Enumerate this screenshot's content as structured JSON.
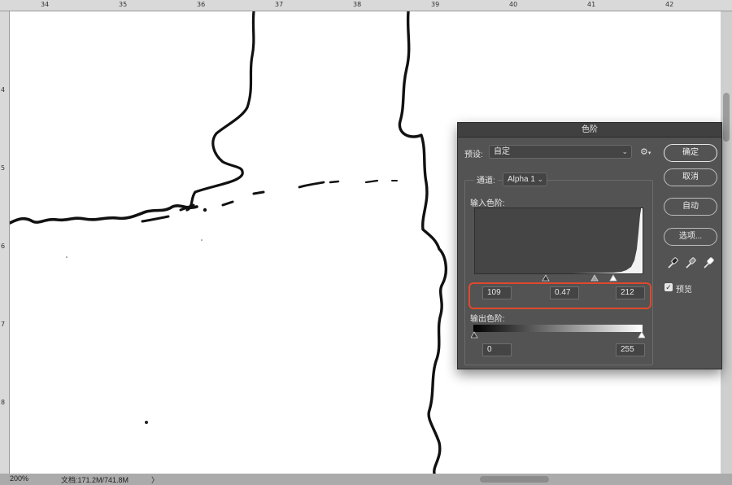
{
  "ruler": {
    "top_marks": [
      "34",
      "35",
      "36",
      "37",
      "38",
      "39",
      "40",
      "41",
      "42"
    ],
    "left_marks": [
      "4",
      "5",
      "6",
      "7",
      "8"
    ]
  },
  "status": {
    "zoom": "200%",
    "doc_size": "文档:171.2M/741.8M",
    "arrow": "〉"
  },
  "dialog": {
    "title": "色阶",
    "preset_label": "预设:",
    "preset_value": "自定",
    "channel_label": "通道:",
    "channel_value": "Alpha 1",
    "input_levels_label": "输入色阶:",
    "input_black": "109",
    "input_gamma": "0.47",
    "input_white": "212",
    "output_levels_label": "输出色阶:",
    "output_black": "0",
    "output_white": "255",
    "buttons": {
      "ok": "确定",
      "cancel": "取消",
      "auto": "自动",
      "options": "选项..."
    },
    "preview_label": "预览",
    "preview_checked": true,
    "highlight_color": "#e0492d"
  }
}
